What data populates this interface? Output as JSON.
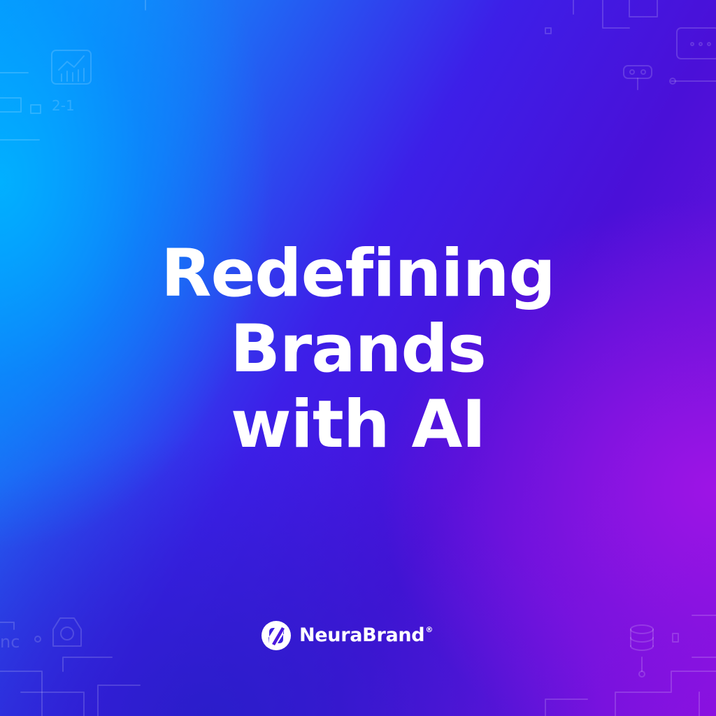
{
  "headline": {
    "line1": "Redefining",
    "line2": "Brands",
    "line3": "with AI"
  },
  "brand": {
    "name": "NeuraBrand",
    "registered": "®",
    "logo_icon": "neurabrand-logo-icon"
  },
  "decorations": {
    "icons": [
      "chart-icon",
      "camera-icon",
      "database-icon",
      "browser-window-icon",
      "robot-icon",
      "circuit-lines"
    ],
    "text_2_1": "2-1",
    "text_nc": "nc"
  },
  "colors": {
    "gradient_cyan": "#0aa2ff",
    "gradient_indigo": "#4a10d8",
    "gradient_violet": "#8a10e0",
    "text": "#ffffff"
  }
}
